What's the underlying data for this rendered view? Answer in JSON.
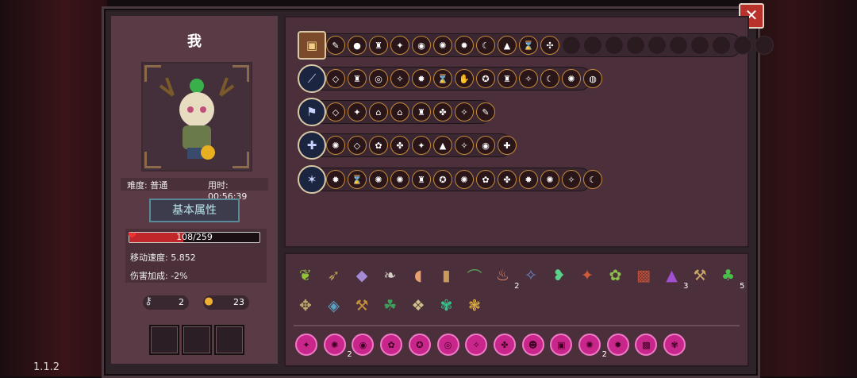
{
  "version": "1.1.2",
  "close_label": "✕",
  "character": {
    "name": "我",
    "difficulty_label": "难度: 普通",
    "time_label": "用时: 00:56:39",
    "attr_button": "基本属性",
    "hp_text": "108/259",
    "hp_fraction": 0.417,
    "move_speed": "移动速度: 5.852",
    "damage_bonus": "伤害加成: -2%",
    "keys": "2",
    "coins": "23"
  },
  "weapon_rows": [
    {
      "lead_icon": "backpack-icon",
      "lead_glyph": "▣",
      "square": true,
      "icons": [
        "✎",
        "●",
        "♜",
        "✦",
        "◉",
        "✺",
        "✹",
        "☾",
        "▲",
        "⌛",
        "✣",
        "",
        "",
        "",
        "",
        "",
        "",
        "",
        "",
        "",
        ""
      ]
    },
    {
      "lead_icon": "purple-feather-sword-icon",
      "lead_glyph": "⟋",
      "icons": [
        "◇",
        "♜",
        "◎",
        "✧",
        "✹",
        "⌛",
        "✋",
        "✪",
        "♜",
        "✧",
        "☾",
        "✺",
        "◍"
      ]
    },
    {
      "lead_icon": "flag-spear-icon",
      "lead_glyph": "⚑",
      "icons": [
        "◇",
        "✦",
        "⌂",
        "⌂",
        "♜",
        "✤",
        "✧",
        "✎"
      ]
    },
    {
      "lead_icon": "ice-mace-icon",
      "lead_glyph": "✚",
      "icons": [
        "✺",
        "◇",
        "✿",
        "✤",
        "✦",
        "▲",
        "✧",
        "◉",
        "✚"
      ]
    },
    {
      "lead_icon": "star-wand-icon",
      "lead_glyph": "✶",
      "icons": [
        "✹",
        "⌛",
        "✺",
        "✺",
        "♜",
        "✪",
        "✺",
        "✿",
        "✤",
        "✹",
        "✺",
        "✧",
        "☾"
      ]
    }
  ],
  "items": [
    {
      "glyph": "❦",
      "color": "#8fc43a"
    },
    {
      "glyph": "➶",
      "color": "#b89a5a"
    },
    {
      "glyph": "◆",
      "color": "#a58ad8"
    },
    {
      "glyph": "❧",
      "color": "#d8d0c8"
    },
    {
      "glyph": "◖",
      "color": "#e8a070"
    },
    {
      "glyph": "▮",
      "color": "#c89a5a"
    },
    {
      "glyph": "⌒",
      "color": "#5aa05a"
    },
    {
      "glyph": "♨",
      "color": "#e89070",
      "count": "2"
    },
    {
      "glyph": "✧",
      "color": "#6a8ad0"
    },
    {
      "glyph": "❥",
      "color": "#5ad08a"
    },
    {
      "glyph": "✦",
      "color": "#d05a3a"
    },
    {
      "glyph": "✿",
      "color": "#8ac04a"
    },
    {
      "glyph": "▩",
      "color": "#c0503a"
    },
    {
      "glyph": "▲",
      "color": "#a050d0",
      "count": "3"
    },
    {
      "glyph": "⚒",
      "color": "#c8a86a"
    },
    {
      "glyph": "♣",
      "color": "#4ac04a",
      "count": "5"
    },
    {
      "glyph": "✥",
      "color": "#b8a86a"
    },
    {
      "glyph": "◈",
      "color": "#5aa0c0"
    },
    {
      "glyph": "⚒",
      "color": "#c8903a"
    },
    {
      "glyph": "☘",
      "color": "#3aa05a"
    },
    {
      "glyph": "❖",
      "color": "#d0c08a"
    },
    {
      "glyph": "✾",
      "color": "#3ac08a"
    },
    {
      "glyph": "❃",
      "color": "#e0b040"
    }
  ],
  "gems": [
    {
      "glyph": "✦"
    },
    {
      "glyph": "✺",
      "count": "2"
    },
    {
      "glyph": "◉"
    },
    {
      "glyph": "✿"
    },
    {
      "glyph": "✪"
    },
    {
      "glyph": "◎"
    },
    {
      "glyph": "✧"
    },
    {
      "glyph": "✤"
    },
    {
      "glyph": "☻"
    },
    {
      "glyph": "▣"
    },
    {
      "glyph": "✺",
      "count": "2"
    },
    {
      "glyph": "✹"
    },
    {
      "glyph": "▩"
    },
    {
      "glyph": "✾"
    }
  ]
}
